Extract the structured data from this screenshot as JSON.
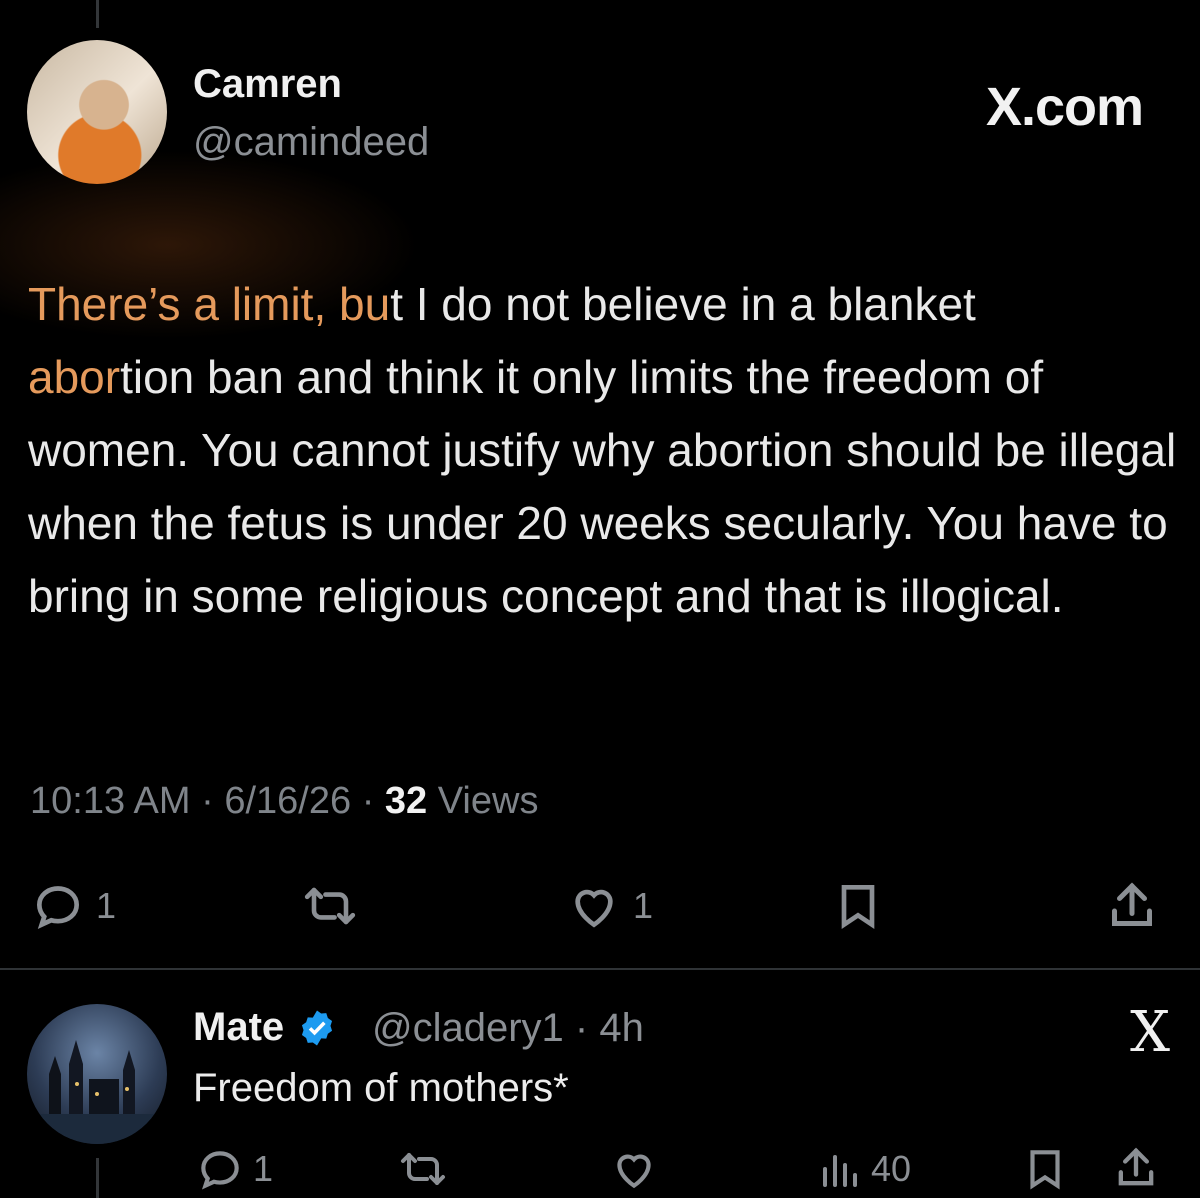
{
  "watermark": "X.com",
  "tweet": {
    "author_name": "Camren",
    "author_handle": "@camindeed",
    "text_highlight_1": "There’s a limit, bu",
    "text_1": "t I do not believe in a blanket",
    "text_highlight_2": "abor",
    "text_2": "tion ban and think it only limits the freedom of women. You cannot justify why abortion should be illegal when the fetus is under 20 weeks secularly. You have to bring in some religious concept and that is illogical.",
    "time": "10:13 AM",
    "date": "6/16/26",
    "views_count": "32",
    "views_label": "Views",
    "reply_count": "1",
    "like_count": "1"
  },
  "reply": {
    "author_name": "Mate",
    "author_handle": "@cladery1",
    "age": "4h",
    "text": "Freedom of mothers*",
    "reply_count": "1",
    "views_count": "40"
  },
  "colors": {
    "background": "#000000",
    "highlight": "#e59a5c",
    "muted": "#8b8f94",
    "verified": "#1d9bf0"
  },
  "icons": [
    "reply-icon",
    "retweet-icon",
    "like-icon",
    "bookmark-icon",
    "share-icon",
    "views-icon",
    "verified-icon",
    "close-icon"
  ]
}
